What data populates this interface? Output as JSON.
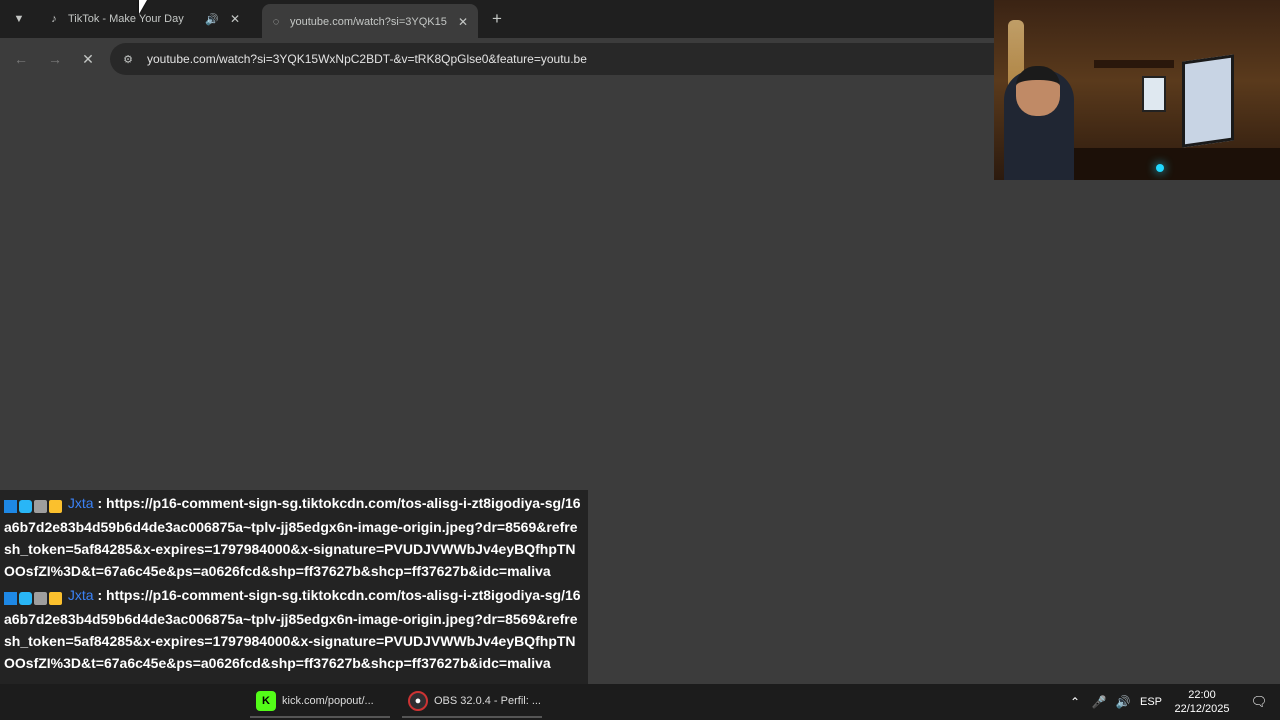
{
  "browser": {
    "tabs": [
      {
        "title": "TikTok - Make Your Day",
        "favicon": "tiktok-icon",
        "audio_icon": "speaker-icon",
        "active": false
      },
      {
        "title": "youtube.com/watch?si=3YQK15",
        "favicon": "loading-icon",
        "active": true
      }
    ],
    "address_bar": {
      "url": "youtube.com/watch?si=3YQK15WxNpC2BDT-&v=tRK8QpGlse0&feature=youtu.be"
    },
    "colors": {
      "tabstrip": "#1f1f1f",
      "toolbar": "#3c3c3c",
      "omnibox": "#282828"
    }
  },
  "chat": {
    "messages": [
      {
        "username": "Jxta",
        "separator": ":",
        "text": "https://p16-comment-sign-sg.tiktokcdn.com/tos-alisg-i-zt8igodiya-sg/16a6b7d2e83b4d59b6d4de3ac006875a~tplv-jj85edgx6n-image-origin.jpeg?dr=8569&refresh_token=5af84285&x-expires=1797984000&x-signature=PVUDJVWWbJv4eyBQfhpTNOOsfZI%3D&t=67a6c45e&ps=a0626fcd&shp=ff37627b&shcp=ff37627b&idc=maliva"
      },
      {
        "username": "Jxta",
        "separator": ":",
        "text": "https://p16-comment-sign-sg.tiktokcdn.com/tos-alisg-i-zt8igodiya-sg/16a6b7d2e83b4d59b6d4de3ac006875a~tplv-jj85edgx6n-image-origin.jpeg?dr=8569&refresh_token=5af84285&x-expires=1797984000&x-signature=PVUDJVWWbJv4eyBQfhpTNOOsfZI%3D&t=67a6c45e&ps=a0626fcd&shp=ff37627b&shcp=ff37627b&idc=maliva"
      }
    ],
    "username_color": "#3b82f6"
  },
  "taskbar": {
    "apps": [
      {
        "label": "kick.com/popout/...",
        "icon": "kick-icon"
      },
      {
        "label": "OBS 32.0.4 - Perfil: ...",
        "icon": "obs-icon"
      }
    ],
    "tray": {
      "language": "ESP",
      "time": "22:00",
      "date": "22/12/2025"
    }
  }
}
